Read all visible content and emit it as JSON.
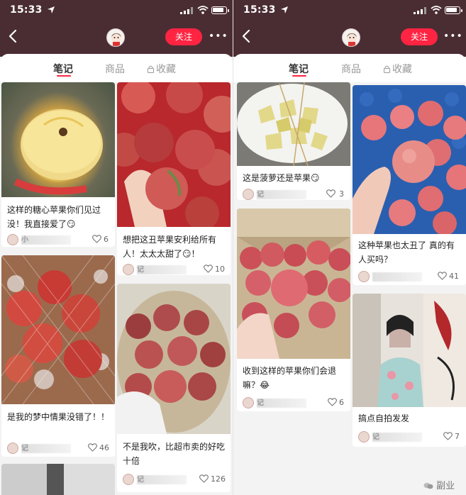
{
  "left_screen": {
    "status_bar": {
      "time": "15:33"
    },
    "header": {
      "follow_label": "关注",
      "more_label": "•••"
    },
    "tabs": [
      {
        "label": "笔记",
        "active": true
      },
      {
        "label": "商品",
        "active": false
      },
      {
        "label": "收藏",
        "active": false
      }
    ],
    "posts": [
      {
        "title": "这样的糖心苹果你们见过没！我直接爱了😏",
        "author": "小",
        "likes": "6"
      },
      {
        "title": "想把这丑苹果安利给所有人！太太太甜了😏！",
        "author": "记",
        "likes": "10"
      },
      {
        "title": "是我的梦中情果没错了！！",
        "author": "记",
        "likes": "46"
      },
      {
        "title": "不是我吹，比超市卖的好吃十倍",
        "author": "记",
        "likes": "126"
      }
    ]
  },
  "right_screen": {
    "status_bar": {
      "time": "15:33"
    },
    "header": {
      "follow_label": "关注",
      "more_label": "•••"
    },
    "tabs": [
      {
        "label": "笔记",
        "active": true
      },
      {
        "label": "商品",
        "active": false
      },
      {
        "label": "收藏",
        "active": false
      }
    ],
    "posts": [
      {
        "title": "这是菠萝还是苹果😏",
        "author": "记",
        "likes": "3"
      },
      {
        "title": "这种苹果也太丑了 真的有人买吗？",
        "author": "",
        "likes": "41"
      },
      {
        "title": "收到这样的苹果你们会退嘛？😂",
        "author": "记",
        "likes": "6"
      },
      {
        "title": "搞点自拍发发",
        "author": "记",
        "likes": "7"
      }
    ]
  },
  "watermark": {
    "text": "副业"
  },
  "colors": {
    "brand_red": "#ff2442",
    "topbar": "#4a2d33",
    "background": "#f3f3f3"
  }
}
